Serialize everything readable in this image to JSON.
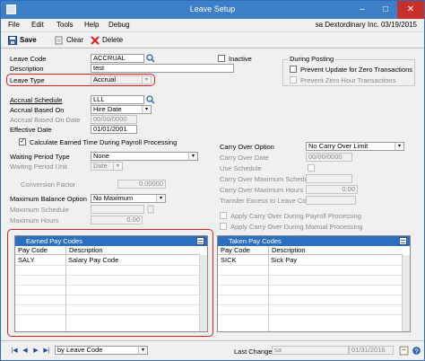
{
  "window": {
    "title": "Leave Setup",
    "minimize": "–",
    "maximize": "□",
    "close": "✕"
  },
  "menu": {
    "items": [
      "File",
      "Edit",
      "Tools",
      "Help",
      "Debug"
    ],
    "info": "sa  Dextordinary Inc.  03/19/2015"
  },
  "toolbar": {
    "save": "Save",
    "clear": "Clear",
    "delete": "Delete"
  },
  "form": {
    "leave_code_label": "Leave Code",
    "leave_code_value": "ACCRUAL",
    "inactive_label": "Inactive",
    "description_label": "Description",
    "description_value": "test",
    "leave_type_label": "Leave Type",
    "leave_type_value": "Accrual",
    "accrual_schedule_label": "Accrual Schedule",
    "accrual_schedule_value": "LLL",
    "accrual_based_on_label": "Accrual Based On",
    "accrual_based_on_value": "Hire Date",
    "accrual_based_on_date_label": "Accrual Based On Date",
    "accrual_based_on_date_value": "00/00/0000",
    "effective_date_label": "Effective Date",
    "effective_date_value": "01/01/2001",
    "calc_earned_label": "Calculate Earned Time During Payroll Processing",
    "waiting_period_type_label": "Waiting Period Type",
    "waiting_period_type_value": "None",
    "waiting_period_unit_label": "Waiting Period Unit",
    "waiting_period_unit_value": "Date",
    "conversion_factor_label": "Conversion Factor",
    "conversion_factor_value": "0.00000",
    "max_balance_option_label": "Maximum Balance Option",
    "max_balance_option_value": "No Maximum",
    "max_schedule_label": "Maximum Schedule",
    "max_hours_label": "Maximum Hours",
    "max_hours_value": "0.00"
  },
  "posting": {
    "group_label": "During Posting",
    "prevent_update_label": "Prevent Update for Zero Transactions",
    "prevent_zero_hour_label": "Prevent Zero Hour Transactions"
  },
  "carry": {
    "option_label": "Carry Over Option",
    "option_value": "No Carry Over Limit",
    "date_label": "Carry Over Date",
    "date_value": "00/00/0000",
    "use_schedule_label": "Use Schedule",
    "max_schedule_label": "Carry Over Maximum Schedule",
    "max_hours_label": "Carry Over Maximum Hours",
    "max_hours_value": "0.00",
    "transfer_label": "Transfer Excess to Leave Code",
    "apply_payroll_label": "Apply Carry Over During Payroll Processing",
    "apply_manual_label": "Apply Carry Over During Manual Processing"
  },
  "earned_grid": {
    "title": "Earned Pay Codes",
    "columns": [
      "Pay Code",
      "Description"
    ],
    "rows": [
      {
        "code": "SALY",
        "desc": "Salary Pay Code"
      }
    ]
  },
  "taken_grid": {
    "title": "Taken Pay Codes",
    "columns": [
      "Pay Code",
      "Description"
    ],
    "rows": [
      {
        "code": "SICK",
        "desc": "Sick Pay"
      }
    ]
  },
  "footer": {
    "sort_value": "by Leave Code",
    "last_change_label": "Last Change",
    "last_change_user": "sa",
    "last_change_date": "01/31/2016"
  },
  "colors": {
    "accent": "#2c6fc0",
    "highlight": "#d42020"
  }
}
